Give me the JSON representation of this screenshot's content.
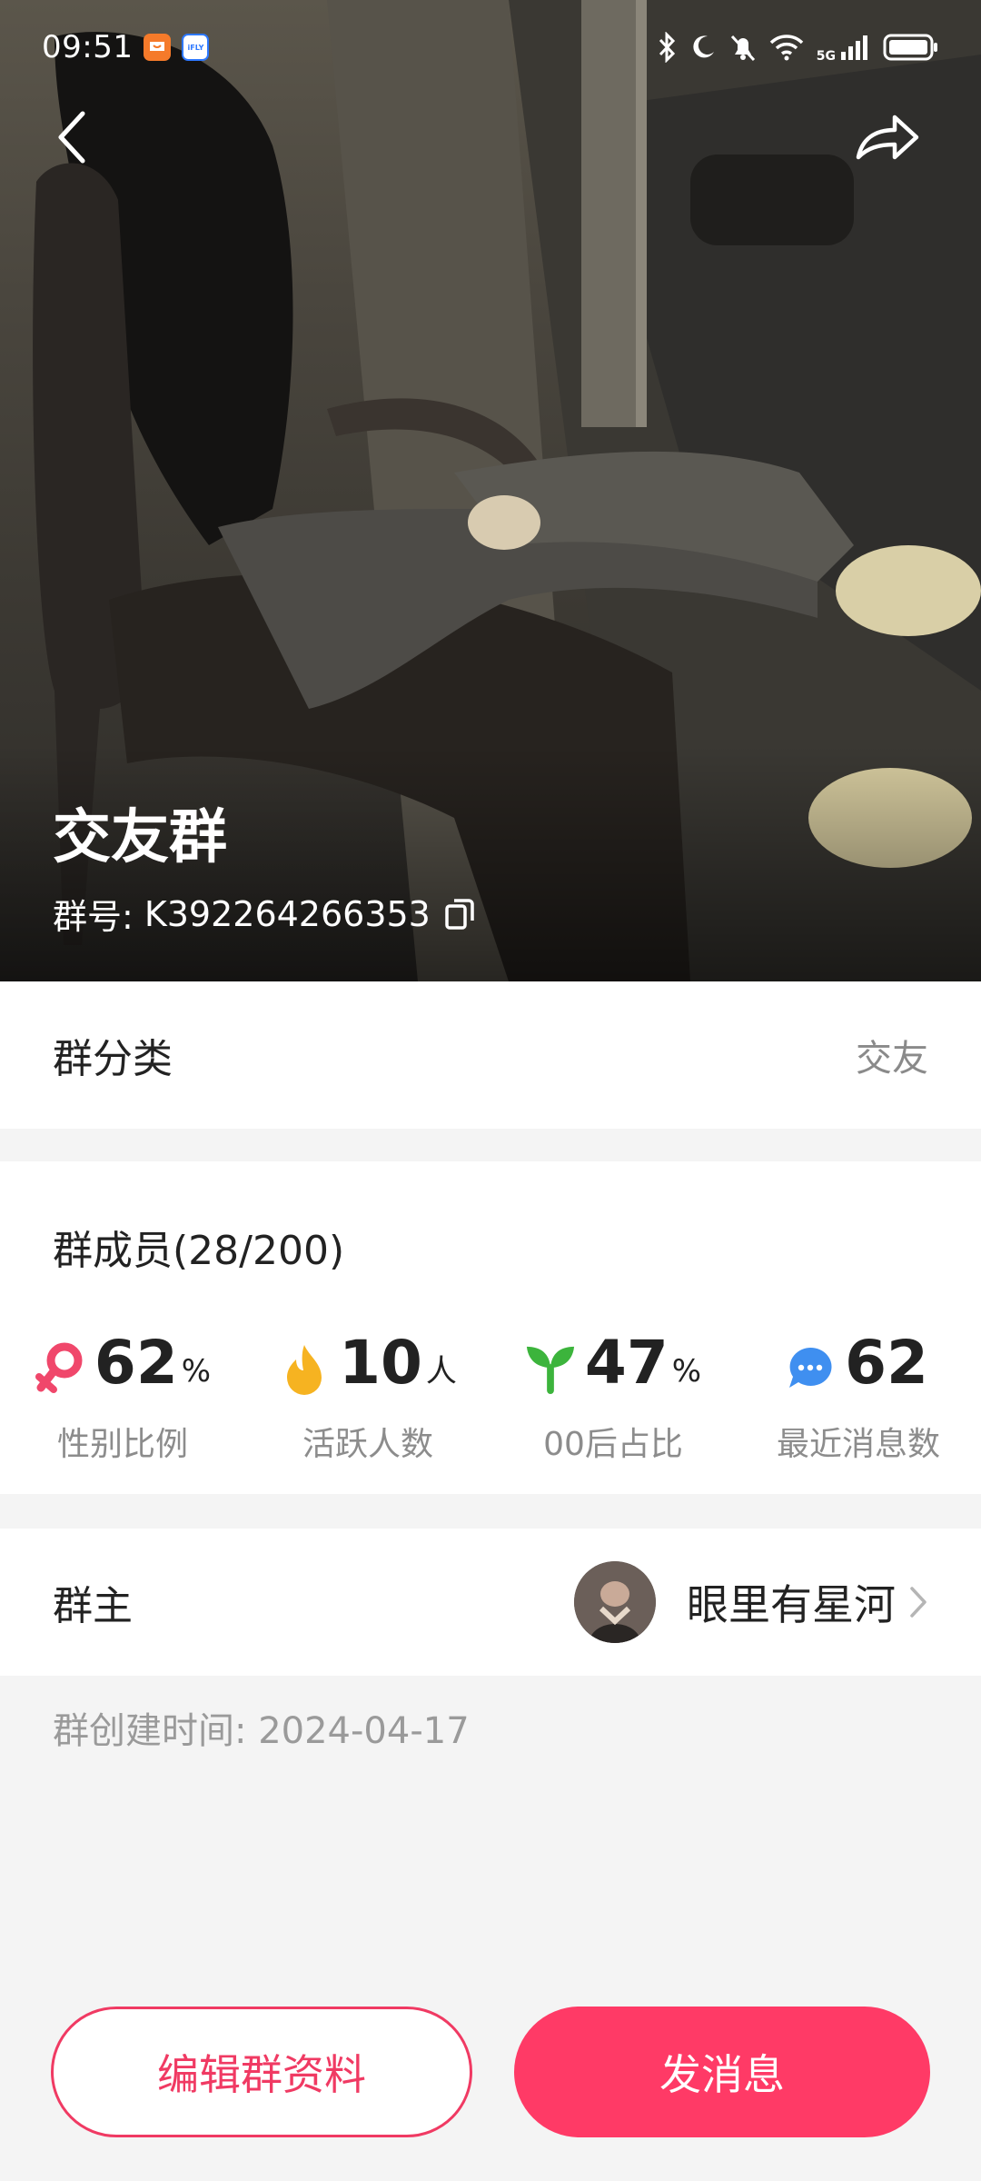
{
  "status_bar": {
    "time": "09:51",
    "app_icons": [
      "notification-app-icon",
      "ifly-icon"
    ],
    "ifly_text": "iFLY",
    "network": "5G",
    "icons": [
      "bluetooth-icon",
      "moon-icon",
      "mute-bell-icon",
      "wifi-icon",
      "signal-icon",
      "battery-icon"
    ]
  },
  "header": {
    "back_icon": "back-icon",
    "share_icon": "share-icon"
  },
  "group": {
    "name": "交友群",
    "id_label": "群号:",
    "id_value": "K392264266353"
  },
  "category": {
    "label": "群分类",
    "value": "交友"
  },
  "members": {
    "title": "群成员(28/200)",
    "stats": [
      {
        "icon": "female-icon",
        "value": "62",
        "unit": "%",
        "label": "性别比例",
        "color": "#f0476b"
      },
      {
        "icon": "flame-icon",
        "value": "10",
        "unit": "人",
        "label": "活跃人数",
        "color": "#f6b321"
      },
      {
        "icon": "sprout-icon",
        "value": "47",
        "unit": "%",
        "label": "00后占比",
        "color": "#3cb43c"
      },
      {
        "icon": "chat-bubble-icon",
        "value": "62",
        "unit": "",
        "label": "最近消息数",
        "color": "#3f8ff0"
      }
    ]
  },
  "owner": {
    "label": "群主",
    "name": "眼里有星河"
  },
  "created": "群创建时间: 2024-04-17",
  "buttons": {
    "edit": "编辑群资料",
    "send": "发消息"
  },
  "colors": {
    "accent": "#ff3a66",
    "text": "#222222",
    "muted": "#8c8c8c",
    "background": "#f4f4f4"
  }
}
